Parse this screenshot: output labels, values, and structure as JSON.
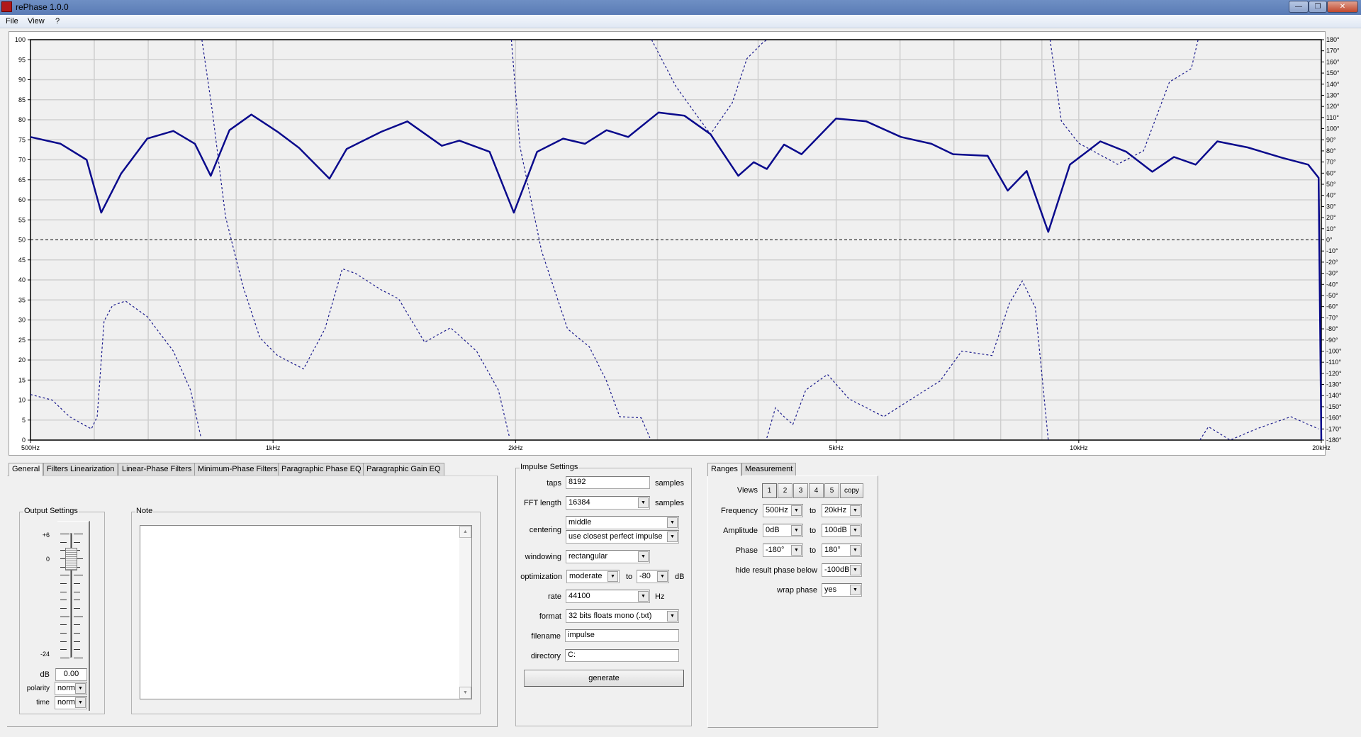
{
  "window": {
    "title": "rePhase 1.0.0",
    "minimize": "—",
    "restore": "❐",
    "close": "✕"
  },
  "menu": [
    "File",
    "View",
    "?"
  ],
  "tabs": [
    "General",
    "Filters Linearization",
    "Linear-Phase Filters",
    "Minimum-Phase Filters",
    "Paragraphic Phase EQ",
    "Paragraphic Gain EQ"
  ],
  "output_settings": {
    "title": "Output Settings",
    "scale_top": "+6",
    "scale_zero": "0",
    "scale_bottom": "-24",
    "gain_db": 0,
    "db_label": "dB",
    "db_value": "0.00",
    "polarity_label": "polarity",
    "polarity_value": "norm",
    "time_label": "time",
    "time_value": "norm"
  },
  "note": {
    "title": "Note",
    "text": ""
  },
  "impulse": {
    "title": "Impulse Settings",
    "taps_label": "taps",
    "taps": "8192",
    "taps_unit": "samples",
    "fft_label": "FFT length",
    "fft": "16384",
    "fft_unit": "samples",
    "centering_label": "centering",
    "centering": "middle",
    "centering2": "use closest perfect impulse",
    "windowing_label": "windowing",
    "windowing": "rectangular",
    "optimization_label": "optimization",
    "optimization": "moderate",
    "opt_to": "to",
    "opt_level": "-80",
    "opt_unit": "dB",
    "rate_label": "rate",
    "rate": "44100",
    "rate_unit": "Hz",
    "format_label": "format",
    "format": "32 bits floats mono (.txt)",
    "filename_label": "filename",
    "filename": "impulse",
    "directory_label": "directory",
    "directory": "C:",
    "generate": "generate"
  },
  "ranges": {
    "tabs": [
      "Ranges",
      "Measurement"
    ],
    "views_label": "Views",
    "views": [
      "1",
      "2",
      "3",
      "4",
      "5",
      "copy"
    ],
    "to": "to",
    "frequency_label": "Frequency",
    "freq_from": "500Hz",
    "freq_to": "20kHz",
    "amplitude_label": "Amplitude",
    "amp_from": "0dB",
    "amp_to": "100dB",
    "phase_label": "Phase",
    "phase_from": "-180°",
    "phase_to": "180°",
    "hide_label": "hide result phase below",
    "hide_value": "-100dB",
    "wrap_label": "wrap phase",
    "wrap_value": "yes"
  },
  "chart_data": {
    "type": "line",
    "xscale": "log",
    "xlim": [
      500,
      20000
    ],
    "ylim": [
      0,
      100
    ],
    "y2lim": [
      -180,
      180
    ],
    "x_ticks": [
      {
        "v": 500,
        "label": "500Hz"
      },
      {
        "v": 1000,
        "label": "1kHz"
      },
      {
        "v": 2000,
        "label": "2kHz"
      },
      {
        "v": 5000,
        "label": "5kHz"
      },
      {
        "v": 10000,
        "label": "10kHz"
      },
      {
        "v": 20000,
        "label": "20kHz"
      }
    ],
    "x_grid": [
      600,
      700,
      800,
      900,
      1000,
      2000,
      3000,
      4000,
      5000,
      6000,
      7000,
      8000,
      9000,
      10000
    ],
    "y_ticks": [
      0,
      5,
      10,
      15,
      20,
      25,
      30,
      35,
      40,
      45,
      50,
      55,
      60,
      65,
      70,
      75,
      80,
      85,
      90,
      95,
      100
    ],
    "y2_ticks": [
      "180°",
      "170°",
      "160°",
      "150°",
      "140°",
      "130°",
      "120°",
      "110°",
      "100°",
      "90°",
      "80°",
      "70°",
      "60°",
      "50°",
      "40°",
      "30°",
      "20°",
      "10°",
      "0°",
      "-10°",
      "-20°",
      "-30°",
      "-40°",
      "-50°",
      "-60°",
      "-70°",
      "-80°",
      "-90°",
      "-100°",
      "-110°",
      "-120°",
      "-130°",
      "-140°",
      "-150°",
      "-160°",
      "-170°",
      "-180°"
    ],
    "colors": {
      "amplitude": "#0a0a8c",
      "phase": "#1a1a8c",
      "zero": "#000000",
      "grid": "#cfcfcf",
      "plot_bg": "#f0f0f0"
    },
    "series": [
      {
        "name": "amplitude",
        "unit": "dB",
        "style": "solid",
        "freq": [
          500,
          545,
          587,
          612,
          648,
          698,
          752,
          800,
          837,
          883,
          940,
          1013,
          1077,
          1175,
          1234,
          1363,
          1468,
          1620,
          1703,
          1857,
          1990,
          2127,
          2291,
          2438,
          2594,
          2759,
          3009,
          3241,
          3491,
          3779,
          3950,
          4101,
          4308,
          4528,
          4998,
          5450,
          6017,
          6562,
          6982,
          7707,
          8162,
          8617,
          9165,
          9752,
          10637,
          11457,
          12339,
          13127,
          13966,
          14857,
          16201,
          17889,
          19266,
          19846
        ],
        "values": [
          75.7,
          74,
          70,
          56.8,
          66.6,
          75.3,
          77.2,
          74,
          66,
          77.4,
          81.3,
          77,
          73,
          65.3,
          72.7,
          77,
          79.6,
          73.5,
          74.8,
          72,
          56.8,
          72,
          75.3,
          74,
          77.4,
          75.7,
          81.8,
          81,
          76.4,
          66,
          69.4,
          67.7,
          73.8,
          71.4,
          80.3,
          79.6,
          75.7,
          74,
          71.4,
          71,
          62.3,
          67.2,
          52,
          68.8,
          74.6,
          72,
          67,
          70.7,
          68.8,
          74.6,
          73.1,
          70.5,
          68.8,
          65.5
        ]
      },
      {
        "name": "phase",
        "unit": "deg",
        "style": "dotted",
        "wrapped": true,
        "segments": [
          {
            "freq": [
              500,
              532,
              559,
              595,
              605,
              617,
              632,
              656,
              698,
              752,
              790,
              814
            ],
            "values": [
              -139,
              -144,
              -159,
              -170,
              -159,
              -73,
              -59,
              -55,
              -69,
              -100,
              -135,
              -178
            ]
          },
          {
            "freq": [
              816,
              841,
              873,
              917,
              963,
              1013,
              1091,
              1160,
              1219,
              1265,
              1363,
              1432,
              1542,
              1661,
              1789,
              1904,
              1966
            ],
            "values": [
              180,
              115,
              21,
              -41,
              -88,
              -104,
              -116,
              -80,
              -26,
              -30,
              -45,
              -53,
              -92,
              -79,
              -100,
              -135,
              -178
            ]
          },
          {
            "freq": [
              1976,
              2025,
              2154,
              2320,
              2469,
              2594,
              2693,
              2864,
              2936
            ],
            "values": [
              180,
              84,
              -10,
              -80,
              -96,
              -127,
              -159,
              -160,
              -178
            ]
          },
          {
            "freq": [
              2950,
              3162,
              3491,
              3714,
              3874,
              4050,
              4101
            ],
            "values": [
              180,
              138,
              95,
              123,
              163,
              177,
              180
            ]
          },
          {
            "freq": [
              4101,
              4203,
              4308,
              4417,
              4583,
              4877,
              5187,
              5728,
              6169,
              6727,
              7157,
              7803,
              8202,
              8510,
              8833,
              9165
            ],
            "values": [
              -178,
              -151,
              -159,
              -166,
              -135,
              -121,
              -143,
              -159,
              -144,
              -127,
              -100,
              -104,
              -57,
              -37,
              -61,
              -180
            ]
          },
          {
            "freq": [
              9213,
              9514,
              9996,
              11173,
              12034,
              12960,
              13795,
              14065
            ],
            "values": [
              180,
              107,
              87,
              68,
              80,
              142,
              154,
              180
            ]
          },
          {
            "freq": [
              14135,
              14488,
              15414,
              16610,
              18333,
              19846
            ],
            "values": [
              -180,
              -168,
              -180,
              -170,
              -159,
              -170
            ]
          }
        ]
      }
    ]
  }
}
